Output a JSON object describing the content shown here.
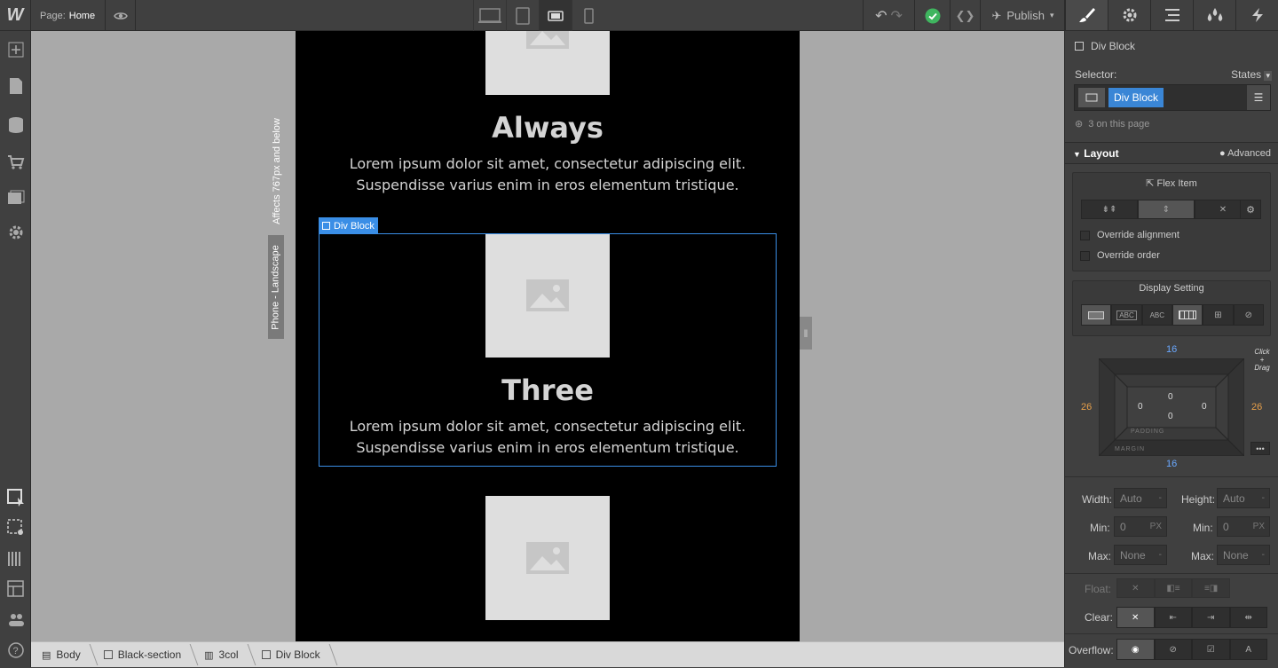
{
  "topbar": {
    "logo": "W",
    "page_label": "Page:",
    "page_name": "Home",
    "publish_label": "Publish"
  },
  "canvas": {
    "heading_always": "Always",
    "heading_three": "Three",
    "body_line1": "Lorem ipsum dolor sit amet, consectetur adipiscing elit.",
    "body_line2": "Suspendisse varius enim in eros elementum tristique.",
    "selected_tag": "Div Block",
    "breakpoint_note": "Affects 767px and below",
    "breakpoint_name": "Phone - Landscape"
  },
  "breadcrumb": [
    "Body",
    "Black-section",
    "3col",
    "Div Block"
  ],
  "panel": {
    "element_name": "Div Block",
    "selector_label": "Selector:",
    "states_label": "States",
    "selector_chip": "Div Block",
    "on_page": "3 on this page",
    "layout_title": "Layout",
    "advanced_label": "Advanced",
    "flex_item_title": "Flex Item",
    "override_alignment": "Override alignment",
    "override_order": "Override order",
    "display_title": "Display Setting",
    "display_options": [
      "",
      "ABC",
      "ABC",
      "",
      "",
      ""
    ],
    "click_drag": "Click + Drag",
    "margin_top": "16",
    "margin_bottom": "16",
    "margin_left": "26",
    "margin_right": "26",
    "padding_top": "0",
    "padding_bottom": "0",
    "padding_left": "0",
    "padding_right": "0",
    "padding_label": "PADDING",
    "margin_label": "MARGIN",
    "width_label": "Width:",
    "width_value": "Auto",
    "height_label": "Height:",
    "height_value": "Auto",
    "min_label": "Min:",
    "min_w": "0",
    "min_h": "0",
    "px": "PX",
    "max_label": "Max:",
    "max_w": "None",
    "max_h": "None",
    "float_label": "Float:",
    "clear_label": "Clear:",
    "overflow_label": "Overflow:"
  }
}
